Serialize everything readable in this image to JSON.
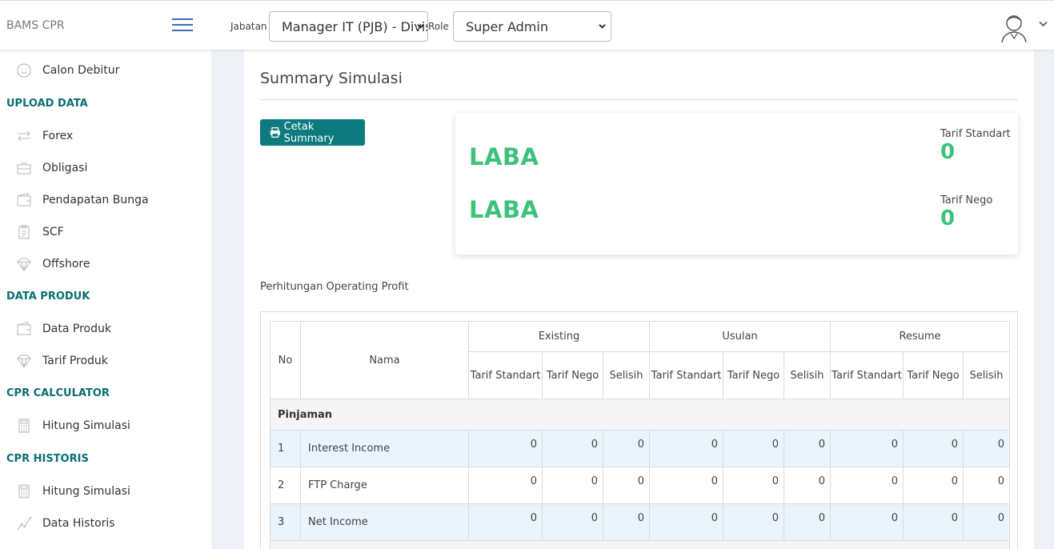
{
  "app": {
    "brand": "BAMS CPR"
  },
  "topbar": {
    "jabatan_label": "Jabatan",
    "jabatan_value": "Manager IT (PJB) - Divisi",
    "role_label": "Role",
    "role_value": "Super Admin"
  },
  "sidebar": {
    "top_item": {
      "label": "Calon Debitur",
      "icon": "smile-icon"
    },
    "sections": [
      {
        "title": "UPLOAD DATA",
        "items": [
          {
            "label": "Forex",
            "icon": "exchange-icon"
          },
          {
            "label": "Obligasi",
            "icon": "briefcase-icon"
          },
          {
            "label": "Pendapatan Bunga",
            "icon": "wallet-icon"
          },
          {
            "label": "SCF",
            "icon": "clipboard-icon"
          },
          {
            "label": "Offshore",
            "icon": "diamond-icon"
          }
        ]
      },
      {
        "title": "DATA PRODUK",
        "items": [
          {
            "label": "Data Produk",
            "icon": "wallet-icon"
          },
          {
            "label": "Tarif Produk",
            "icon": "diamond-icon"
          }
        ]
      },
      {
        "title": "CPR CALCULATOR",
        "items": [
          {
            "label": "Hitung Simulasi",
            "icon": "calculator-icon"
          }
        ]
      },
      {
        "title": "CPR HISTORIS",
        "items": [
          {
            "label": "Hitung Simulasi",
            "icon": "calculator-icon"
          },
          {
            "label": "Data Historis",
            "icon": "chart-line-icon"
          }
        ]
      }
    ]
  },
  "main": {
    "title": "Summary Simulasi",
    "print_button": "Cetak Summary",
    "summary": {
      "laba_1": "LABA",
      "laba_2": "LABA",
      "tarif_standart_label": "Tarif Standart",
      "tarif_standart_value": "0",
      "tarif_nego_label": "Tarif Nego",
      "tarif_nego_value": "0"
    },
    "section_label": "Perhitungan Operating Profit",
    "table": {
      "col_no": "No",
      "col_nama": "Nama",
      "groups": [
        "Existing",
        "Usulan",
        "Resume"
      ],
      "sub_tarif_standart": "Tarif Standart",
      "sub_tarif_nego": "Tarif Nego",
      "sub_selisih": "Selisih",
      "group_row": "Pinjaman",
      "rows": [
        {
          "no": "1",
          "nama": "Interest Income",
          "values": [
            "0",
            "0",
            "0",
            "0",
            "0",
            "0",
            "0",
            "0",
            "0"
          ]
        },
        {
          "no": "2",
          "nama": "FTP Charge",
          "values": [
            "0",
            "0",
            "0",
            "0",
            "0",
            "0",
            "0",
            "0",
            "0"
          ]
        },
        {
          "no": "3",
          "nama": "Net Income",
          "values": [
            "0",
            "0",
            "0",
            "0",
            "0",
            "0",
            "0",
            "0",
            "0"
          ]
        }
      ]
    }
  },
  "colors": {
    "accent": "#0c7a7f",
    "profit": "#3cc27a",
    "link": "#3b6fb6"
  }
}
